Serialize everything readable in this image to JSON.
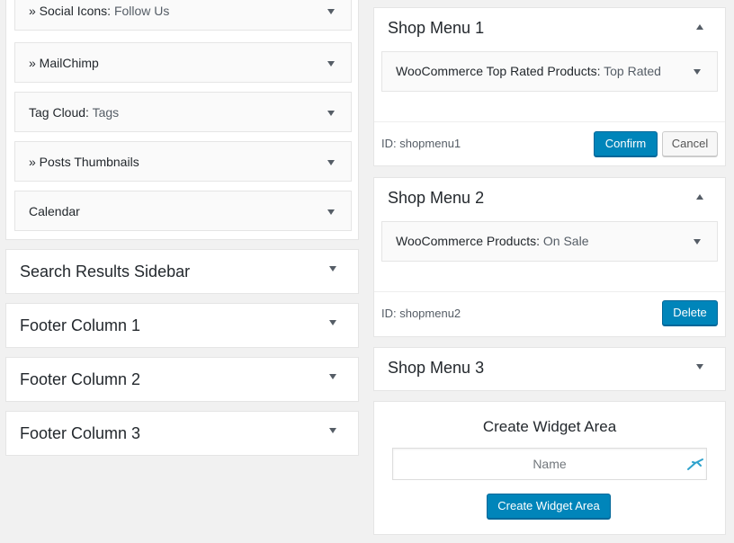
{
  "left": {
    "widgets": [
      {
        "name": "» Social Icons:",
        "sub": "Follow Us"
      },
      {
        "name": "» MailChimp",
        "sub": ""
      },
      {
        "name": "Tag Cloud:",
        "sub": "Tags"
      },
      {
        "name": "» Posts Thumbnails",
        "sub": ""
      },
      {
        "name": "Calendar",
        "sub": ""
      }
    ],
    "sidebars": [
      "Search Results Sidebar",
      "Footer Column 1",
      "Footer Column 2",
      "Footer Column 3"
    ]
  },
  "right": {
    "shop_menu_1": {
      "title": "Shop Menu 1",
      "widget_name": "WooCommerce Top Rated Products:",
      "widget_sub": "Top Rated",
      "id_text": "ID: shopmenu1",
      "confirm_label": "Confirm",
      "cancel_label": "Cancel"
    },
    "shop_menu_2": {
      "title": "Shop Menu 2",
      "widget_name": "WooCommerce Products:",
      "widget_sub": "On Sale",
      "id_text": "ID: shopmenu2",
      "delete_label": "Delete"
    },
    "shop_menu_3": {
      "title": "Shop Menu 3"
    },
    "create_area": {
      "title": "Create Widget Area",
      "name_placeholder": "Name",
      "button_label": "Create Widget Area"
    }
  },
  "colors": {
    "primary_button": "#0085ba",
    "background": "#f1f1f1"
  }
}
